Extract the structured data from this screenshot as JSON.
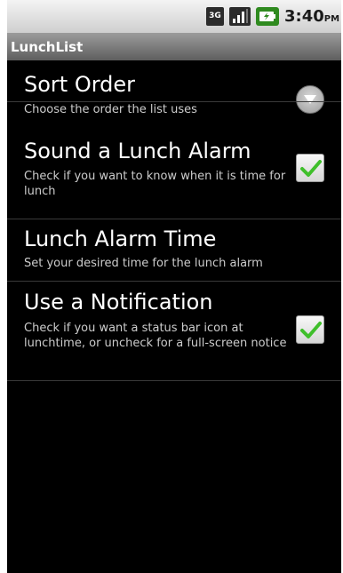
{
  "status_bar": {
    "network_label": "3G",
    "time": "3:40",
    "ampm": "PM",
    "network_icon": "3g-icon",
    "signal_icon": "signal-icon",
    "battery_icon": "battery-icon"
  },
  "title_bar": {
    "title": "LunchList"
  },
  "preferences": [
    {
      "title": "Sort Order",
      "summary": "Choose the order the list uses",
      "control": "dropdown-arrow-icon"
    },
    {
      "title": "Sound a Lunch Alarm",
      "summary": "Check if you want to know when it is time for lunch",
      "control": "checkbox",
      "checked": true
    },
    {
      "title": "Lunch Alarm Time",
      "summary": "Set your desired time for the lunch alarm"
    },
    {
      "title": "Use a Notification",
      "summary": "Check if you want a status bar icon at lunchtime, or uncheck for a full-screen notice",
      "control": "checkbox",
      "checked": true
    }
  ],
  "colors": {
    "background": "#000000",
    "check_green": "#3fbf2b",
    "title_bar": "#7a7a7a"
  }
}
